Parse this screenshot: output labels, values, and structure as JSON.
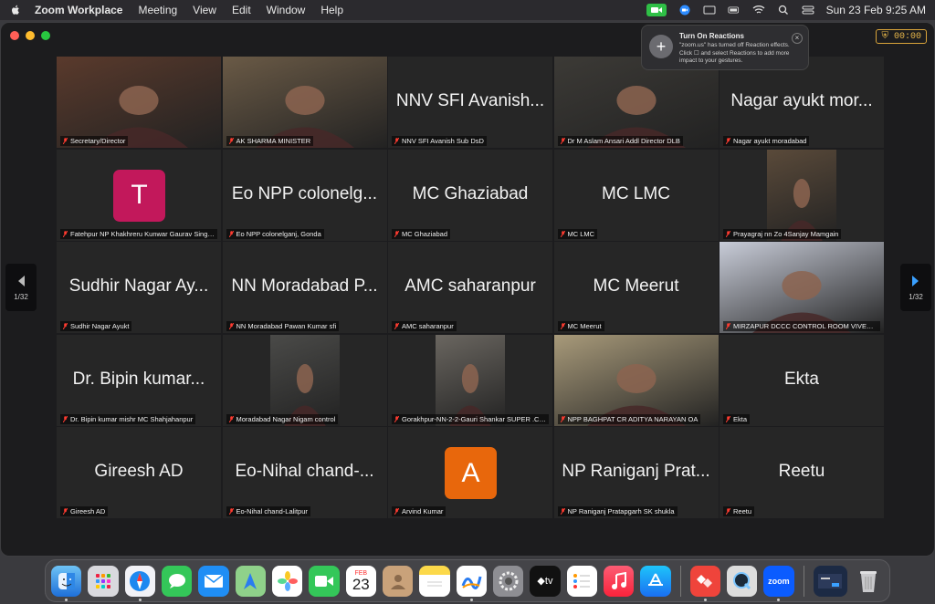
{
  "menubar": {
    "app_name": "Zoom Workplace",
    "menus": [
      "Meeting",
      "View",
      "Edit",
      "Window",
      "Help"
    ],
    "datetime": "Sun 23 Feb  9:25 AM"
  },
  "window": {
    "timer": "00:00",
    "page_indicator": "1/32"
  },
  "notification": {
    "title": "Turn On Reactions",
    "body": "\"zoom.us\" has turned off Reaction effects. Click ☐ and select Reactions to add more impact to your gestures."
  },
  "tiles": [
    {
      "label": "Secretary/Director",
      "video": true,
      "tone": "#5a3a2c"
    },
    {
      "label": "AK SHARMA MINISTER",
      "video": true,
      "tone": "#6a5a46"
    },
    {
      "label": "NNV SFI Avanish Sub DsD",
      "big": "NNV SFI Avanish..."
    },
    {
      "label": "Dr M Aslam Ansari Addl Director DLB",
      "video": true,
      "tone": "#3c3a36"
    },
    {
      "label": "Nagar ayukt moradabad",
      "big": "Nagar ayukt mor..."
    },
    {
      "label": "Fatehpur NP Khakhreru Kunwar Gaurav Singh E...",
      "avatar": "T",
      "avatar_color": "#c2185b"
    },
    {
      "label": "Eo  NPP colonelganj, Gonda",
      "big": "Eo  NPP colonelg..."
    },
    {
      "label": "MC Ghaziabad",
      "big": "MC Ghaziabad"
    },
    {
      "label": "MC LMC",
      "big": "MC LMC"
    },
    {
      "label": "Prayagraj nn Zo 4Sanjay Mamgain",
      "video": true,
      "tone": "#5a4a3a"
    },
    {
      "label": "Sudhir Nagar Ayukt",
      "big": "Sudhir Nagar Ay..."
    },
    {
      "label": "NN Moradabad Pawan Kumar sfi",
      "big": "NN Moradabad P..."
    },
    {
      "label": "AMC saharanpur",
      "big": "AMC saharanpur"
    },
    {
      "label": "MC Meerut",
      "big": "MC Meerut"
    },
    {
      "label": "MIRZAPUR DCCC CONTROL ROOM VIVEK KU...",
      "video": true,
      "tone": "#c8ccd8"
    },
    {
      "label": "Dr. Bipin kumar mishr MC Shahjahanpur",
      "big": "Dr. Bipin kumar..."
    },
    {
      "label": "Moradabad Nagar Nigam control",
      "video": true,
      "tone": "#4a4a48"
    },
    {
      "label": "Gorakhpur-NN-2-2-Gauri Shankar SUPER .CLU...",
      "video": true,
      "tone": "#6a6660"
    },
    {
      "label": "NPP BAGHPAT CR ADITYA NARAYAN OA",
      "video": true,
      "tone": "#a89a7a"
    },
    {
      "label": "Ekta",
      "big": "Ekta"
    },
    {
      "label": "Gireesh AD",
      "big": "Gireesh AD"
    },
    {
      "label": "Eo-Nihal chand-Lalitpur",
      "big": "Eo-Nihal chand-..."
    },
    {
      "label": "Arvind Kumar",
      "avatar": "A",
      "avatar_color": "#e8670c"
    },
    {
      "label": "NP Raniganj Pratapgarh SK shukla",
      "big": "NP Raniganj Prat..."
    },
    {
      "label": "Reetu",
      "big": "Reetu"
    }
  ],
  "dock": {
    "calendar_month": "FEB",
    "calendar_day": "23",
    "apps": [
      "finder",
      "launchpad",
      "safari",
      "messages",
      "mail",
      "maps",
      "photos",
      "facetime",
      "calendar",
      "contacts",
      "notes",
      "freeform",
      "settings",
      "tv",
      "reminders",
      "music",
      "app-store",
      "anydesk",
      "quicktime",
      "zoom",
      "screenshot",
      "trash"
    ]
  }
}
